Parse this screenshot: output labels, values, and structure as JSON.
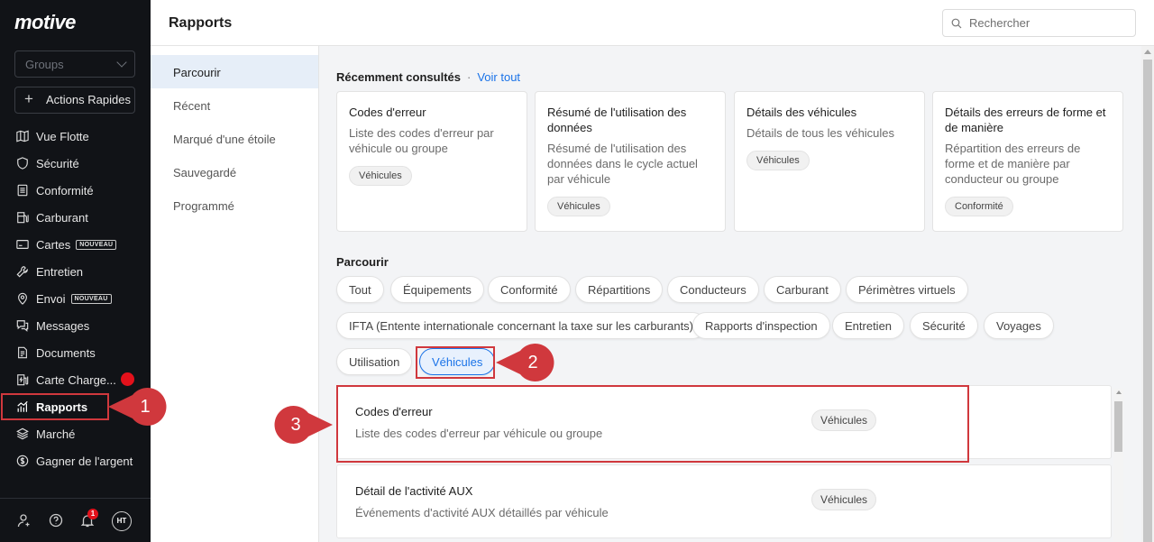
{
  "app": {
    "logo": "motive"
  },
  "sidebar": {
    "groups_placeholder": "Groups",
    "quick_actions": "Actions Rapides",
    "items": [
      {
        "label": "Vue Flotte",
        "icon": "map-icon"
      },
      {
        "label": "Sécurité",
        "icon": "shield-icon"
      },
      {
        "label": "Conformité",
        "icon": "clipboard-icon"
      },
      {
        "label": "Carburant",
        "icon": "fuel-icon"
      },
      {
        "label": "Cartes",
        "icon": "card-icon",
        "tag": "NOUVEAU"
      },
      {
        "label": "Entretien",
        "icon": "wrench-icon"
      },
      {
        "label": "Envoi",
        "icon": "location-icon",
        "tag": "NOUVEAU"
      },
      {
        "label": "Messages",
        "icon": "messages-icon"
      },
      {
        "label": "Documents",
        "icon": "document-icon"
      },
      {
        "label": "Carte Charge...",
        "icon": "charger-icon"
      },
      {
        "label": "Rapports",
        "icon": "reports-icon",
        "active": true
      },
      {
        "label": "Marché",
        "icon": "layers-icon"
      },
      {
        "label": "Gagner de l'argent",
        "icon": "dollar-icon"
      }
    ],
    "bottom": {
      "notifications_count": "1",
      "avatar_initials": "HT"
    }
  },
  "header": {
    "title": "Rapports",
    "search_placeholder": "Rechercher"
  },
  "subnav": {
    "items": [
      "Parcourir",
      "Récent",
      "Marqué d'une étoile",
      "Sauvegardé",
      "Programmé"
    ],
    "active": "Parcourir"
  },
  "recent": {
    "heading": "Récemment consultés",
    "see_all": "Voir tout",
    "cards": [
      {
        "title": "Codes d'erreur",
        "desc": "Liste des codes d'erreur par véhicule ou groupe",
        "tag": "Véhicules"
      },
      {
        "title": "Résumé de l'utilisation des données",
        "desc": "Résumé de l'utilisation des données dans le cycle actuel par véhicule",
        "tag": "Véhicules"
      },
      {
        "title": "Détails des véhicules",
        "desc": "Détails de tous les véhicules",
        "tag": "Véhicules"
      },
      {
        "title": "Détails des erreurs de forme et de manière",
        "desc": "Répartition des erreurs de forme et de manière par conducteur ou groupe",
        "tag": "Conformité"
      }
    ]
  },
  "browse": {
    "heading": "Parcourir",
    "categories": [
      "Tout",
      "Équipements",
      "Conformité",
      "Répartitions",
      "Conducteurs",
      "Carburant",
      "Périmètres virtuels",
      "IFTA (Entente internationale concernant la taxe sur les carburants)",
      "Rapports d'inspection",
      "Entretien",
      "Sécurité",
      "Voyages",
      "Utilisation",
      "Véhicules"
    ],
    "selected": "Véhicules"
  },
  "reports": [
    {
      "title": "Codes d'erreur",
      "desc": "Liste des codes d'erreur par véhicule ou groupe",
      "tag": "Véhicules"
    },
    {
      "title": "Détail de l'activité AUX",
      "desc": "Événements d'activité AUX détaillés par véhicule",
      "tag": "Véhicules"
    }
  ],
  "callouts": [
    "1",
    "2",
    "3"
  ],
  "colors": {
    "accent": "#1a73e8",
    "callout": "#d0383d",
    "sidebar_bg": "#111317",
    "badge": "#e3111b"
  }
}
